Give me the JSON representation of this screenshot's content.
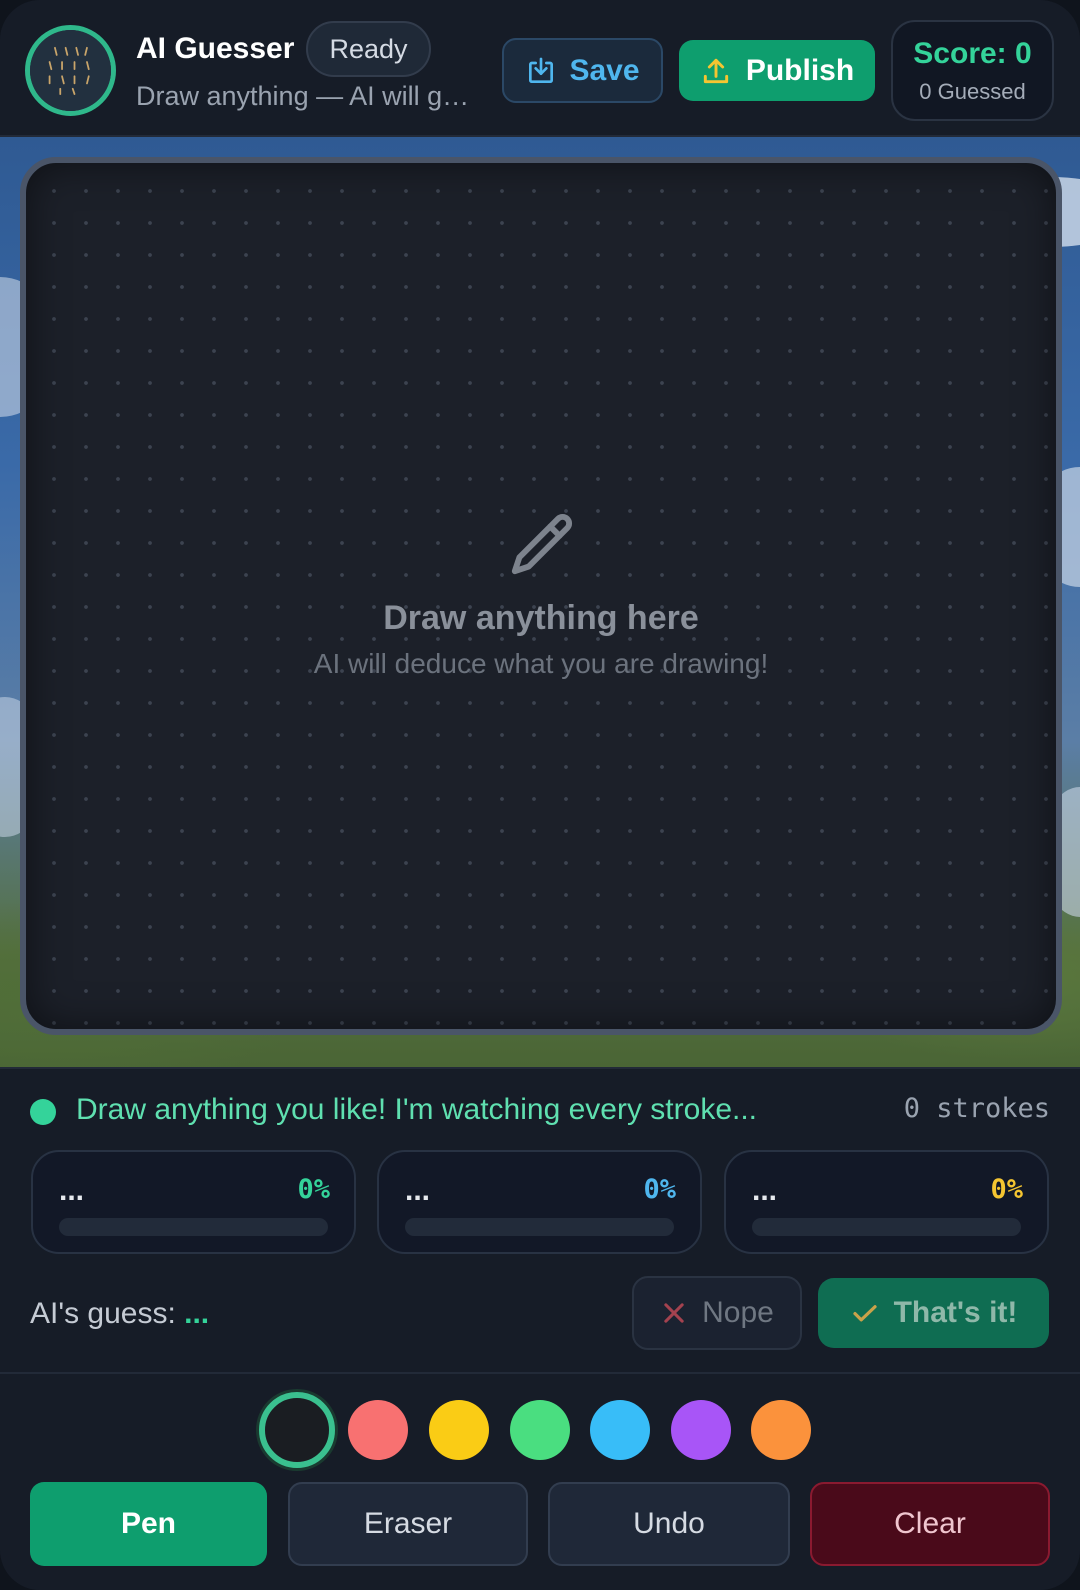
{
  "header": {
    "title": "AI Guesser",
    "status_pill": "Ready",
    "subtitle": "Draw anything — AI will guess what you are drawing!",
    "save_label": "Save",
    "publish_label": "Publish",
    "score_label": "Score: 0",
    "guessed_label": "0 Guessed"
  },
  "canvas": {
    "icon": "pencil-icon",
    "hint_title": "Draw anything here",
    "hint_subtitle": "AI will deduce what you are drawing!"
  },
  "status": {
    "message": "Draw anything you like! I'm watching every stroke...",
    "strokes": "0 strokes"
  },
  "guesses": [
    {
      "label": "...",
      "percent_text": "0%",
      "percent": 0,
      "color": "#34d39a"
    },
    {
      "label": "...",
      "percent_text": "0%",
      "percent": 0,
      "color": "#4fb6ee"
    },
    {
      "label": "...",
      "percent_text": "0%",
      "percent": 0,
      "color": "#f5c531"
    }
  ],
  "ai_guess": {
    "label": "AI's guess:",
    "value": "..."
  },
  "actions": {
    "nope_label": "Nope",
    "yes_label": "That's it!"
  },
  "palette": {
    "selected_index": 0,
    "colors": [
      "#1a1d22",
      "#f87171",
      "#facc15",
      "#4ade80",
      "#38bdf8",
      "#a855f7",
      "#fb923c"
    ]
  },
  "tools": {
    "pen": "Pen",
    "eraser": "Eraser",
    "undo": "Undo",
    "clear": "Clear"
  },
  "colors": {
    "accent": "#0e9e6e",
    "score": "#34d39a",
    "save": "#4fb6ee"
  }
}
